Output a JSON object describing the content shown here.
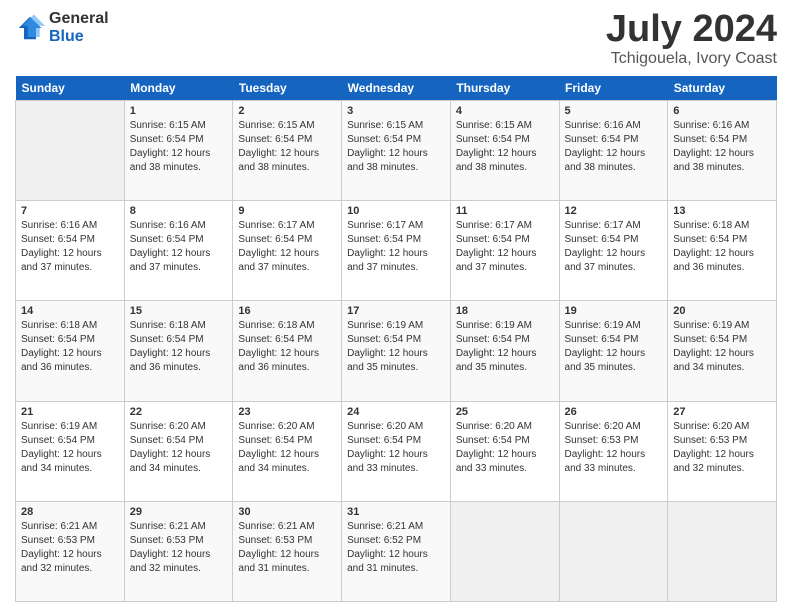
{
  "logo": {
    "general": "General",
    "blue": "Blue"
  },
  "title": "July 2024",
  "subtitle": "Tchigouela, Ivory Coast",
  "weekdays": [
    "Sunday",
    "Monday",
    "Tuesday",
    "Wednesday",
    "Thursday",
    "Friday",
    "Saturday"
  ],
  "weeks": [
    [
      {
        "day": "",
        "sunrise": "",
        "sunset": "",
        "daylight": ""
      },
      {
        "day": "1",
        "sunrise": "Sunrise: 6:15 AM",
        "sunset": "Sunset: 6:54 PM",
        "daylight": "Daylight: 12 hours and 38 minutes."
      },
      {
        "day": "2",
        "sunrise": "Sunrise: 6:15 AM",
        "sunset": "Sunset: 6:54 PM",
        "daylight": "Daylight: 12 hours and 38 minutes."
      },
      {
        "day": "3",
        "sunrise": "Sunrise: 6:15 AM",
        "sunset": "Sunset: 6:54 PM",
        "daylight": "Daylight: 12 hours and 38 minutes."
      },
      {
        "day": "4",
        "sunrise": "Sunrise: 6:15 AM",
        "sunset": "Sunset: 6:54 PM",
        "daylight": "Daylight: 12 hours and 38 minutes."
      },
      {
        "day": "5",
        "sunrise": "Sunrise: 6:16 AM",
        "sunset": "Sunset: 6:54 PM",
        "daylight": "Daylight: 12 hours and 38 minutes."
      },
      {
        "day": "6",
        "sunrise": "Sunrise: 6:16 AM",
        "sunset": "Sunset: 6:54 PM",
        "daylight": "Daylight: 12 hours and 38 minutes."
      }
    ],
    [
      {
        "day": "7",
        "sunrise": "Sunrise: 6:16 AM",
        "sunset": "Sunset: 6:54 PM",
        "daylight": "Daylight: 12 hours and 37 minutes."
      },
      {
        "day": "8",
        "sunrise": "Sunrise: 6:16 AM",
        "sunset": "Sunset: 6:54 PM",
        "daylight": "Daylight: 12 hours and 37 minutes."
      },
      {
        "day": "9",
        "sunrise": "Sunrise: 6:17 AM",
        "sunset": "Sunset: 6:54 PM",
        "daylight": "Daylight: 12 hours and 37 minutes."
      },
      {
        "day": "10",
        "sunrise": "Sunrise: 6:17 AM",
        "sunset": "Sunset: 6:54 PM",
        "daylight": "Daylight: 12 hours and 37 minutes."
      },
      {
        "day": "11",
        "sunrise": "Sunrise: 6:17 AM",
        "sunset": "Sunset: 6:54 PM",
        "daylight": "Daylight: 12 hours and 37 minutes."
      },
      {
        "day": "12",
        "sunrise": "Sunrise: 6:17 AM",
        "sunset": "Sunset: 6:54 PM",
        "daylight": "Daylight: 12 hours and 37 minutes."
      },
      {
        "day": "13",
        "sunrise": "Sunrise: 6:18 AM",
        "sunset": "Sunset: 6:54 PM",
        "daylight": "Daylight: 12 hours and 36 minutes."
      }
    ],
    [
      {
        "day": "14",
        "sunrise": "Sunrise: 6:18 AM",
        "sunset": "Sunset: 6:54 PM",
        "daylight": "Daylight: 12 hours and 36 minutes."
      },
      {
        "day": "15",
        "sunrise": "Sunrise: 6:18 AM",
        "sunset": "Sunset: 6:54 PM",
        "daylight": "Daylight: 12 hours and 36 minutes."
      },
      {
        "day": "16",
        "sunrise": "Sunrise: 6:18 AM",
        "sunset": "Sunset: 6:54 PM",
        "daylight": "Daylight: 12 hours and 36 minutes."
      },
      {
        "day": "17",
        "sunrise": "Sunrise: 6:19 AM",
        "sunset": "Sunset: 6:54 PM",
        "daylight": "Daylight: 12 hours and 35 minutes."
      },
      {
        "day": "18",
        "sunrise": "Sunrise: 6:19 AM",
        "sunset": "Sunset: 6:54 PM",
        "daylight": "Daylight: 12 hours and 35 minutes."
      },
      {
        "day": "19",
        "sunrise": "Sunrise: 6:19 AM",
        "sunset": "Sunset: 6:54 PM",
        "daylight": "Daylight: 12 hours and 35 minutes."
      },
      {
        "day": "20",
        "sunrise": "Sunrise: 6:19 AM",
        "sunset": "Sunset: 6:54 PM",
        "daylight": "Daylight: 12 hours and 34 minutes."
      }
    ],
    [
      {
        "day": "21",
        "sunrise": "Sunrise: 6:19 AM",
        "sunset": "Sunset: 6:54 PM",
        "daylight": "Daylight: 12 hours and 34 minutes."
      },
      {
        "day": "22",
        "sunrise": "Sunrise: 6:20 AM",
        "sunset": "Sunset: 6:54 PM",
        "daylight": "Daylight: 12 hours and 34 minutes."
      },
      {
        "day": "23",
        "sunrise": "Sunrise: 6:20 AM",
        "sunset": "Sunset: 6:54 PM",
        "daylight": "Daylight: 12 hours and 34 minutes."
      },
      {
        "day": "24",
        "sunrise": "Sunrise: 6:20 AM",
        "sunset": "Sunset: 6:54 PM",
        "daylight": "Daylight: 12 hours and 33 minutes."
      },
      {
        "day": "25",
        "sunrise": "Sunrise: 6:20 AM",
        "sunset": "Sunset: 6:54 PM",
        "daylight": "Daylight: 12 hours and 33 minutes."
      },
      {
        "day": "26",
        "sunrise": "Sunrise: 6:20 AM",
        "sunset": "Sunset: 6:53 PM",
        "daylight": "Daylight: 12 hours and 33 minutes."
      },
      {
        "day": "27",
        "sunrise": "Sunrise: 6:20 AM",
        "sunset": "Sunset: 6:53 PM",
        "daylight": "Daylight: 12 hours and 32 minutes."
      }
    ],
    [
      {
        "day": "28",
        "sunrise": "Sunrise: 6:21 AM",
        "sunset": "Sunset: 6:53 PM",
        "daylight": "Daylight: 12 hours and 32 minutes."
      },
      {
        "day": "29",
        "sunrise": "Sunrise: 6:21 AM",
        "sunset": "Sunset: 6:53 PM",
        "daylight": "Daylight: 12 hours and 32 minutes."
      },
      {
        "day": "30",
        "sunrise": "Sunrise: 6:21 AM",
        "sunset": "Sunset: 6:53 PM",
        "daylight": "Daylight: 12 hours and 31 minutes."
      },
      {
        "day": "31",
        "sunrise": "Sunrise: 6:21 AM",
        "sunset": "Sunset: 6:52 PM",
        "daylight": "Daylight: 12 hours and 31 minutes."
      },
      {
        "day": "",
        "sunrise": "",
        "sunset": "",
        "daylight": ""
      },
      {
        "day": "",
        "sunrise": "",
        "sunset": "",
        "daylight": ""
      },
      {
        "day": "",
        "sunrise": "",
        "sunset": "",
        "daylight": ""
      }
    ]
  ]
}
